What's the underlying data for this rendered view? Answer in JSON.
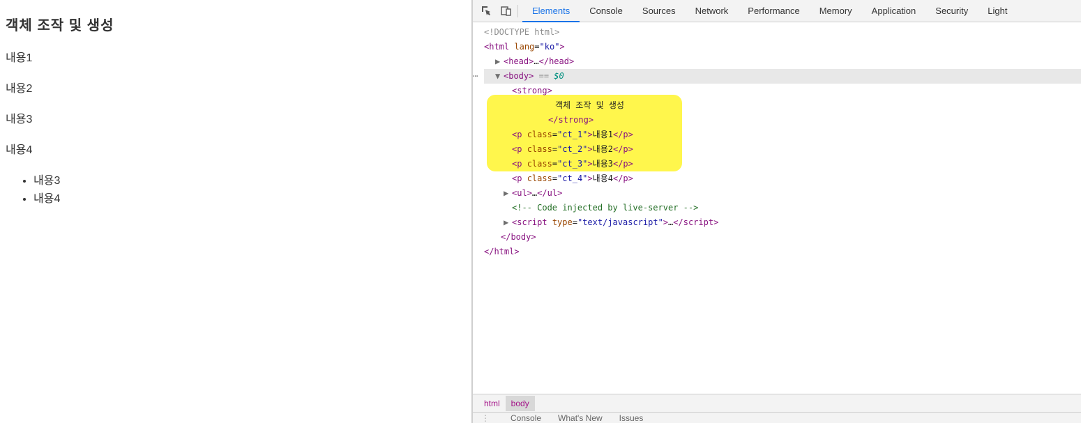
{
  "page": {
    "title": "객체 조작 및 생성",
    "paragraphs": [
      "내용1",
      "내용2",
      "내용3",
      "내용4"
    ],
    "list_items": [
      "내용3",
      "내용4"
    ]
  },
  "devtools": {
    "tabs": [
      "Elements",
      "Console",
      "Sources",
      "Network",
      "Performance",
      "Memory",
      "Application",
      "Security",
      "Light"
    ],
    "active_tab": "Elements",
    "breadcrumb": [
      "html",
      "body"
    ],
    "drawer_tabs": [
      "Console",
      "What's New",
      "Issues"
    ],
    "dom": {
      "doctype": "<!DOCTYPE html>",
      "html_open": "<html lang=\"ko\">",
      "head_collapsed": "<head>…</head>",
      "body_open": "<body>",
      "body_sel_suffix_eq": " == ",
      "body_sel_suffix_var": "$0",
      "strong_open": "<strong>",
      "strong_text": "객체 조작 및 생성",
      "strong_close": "</strong>",
      "p1": "<p class=\"ct_1\">내용1</p>",
      "p2": "<p class=\"ct_2\">내용2</p>",
      "p3": "<p class=\"ct_3\">내용3</p>",
      "p4": "<p class=\"ct_4\">내용4</p>",
      "ul_collapsed": "<ul>…</ul>",
      "comment": "<!-- Code injected by live-server -->",
      "script_collapsed": "<script type=\"text/javascript\">…</",
      "script_collapsed2": "script>",
      "body_close": "</body>",
      "html_close": "</html>"
    }
  }
}
